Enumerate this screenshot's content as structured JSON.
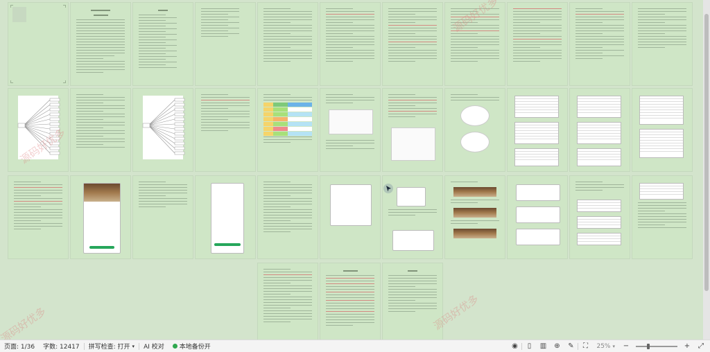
{
  "status": {
    "page_label": "页面: 1/36",
    "word_count_label": "字数: 12417",
    "spell_check_label": "拼写检查: 打开",
    "proof_label": "AI 校对",
    "backup_label": "本地备份开",
    "zoom_level": "25%"
  },
  "watermark": {
    "text": "源码好优多"
  },
  "colors": {
    "page_bg": "#cfe6c6",
    "workspace_bg": "#d3e4cc",
    "accent_green": "#2fa84f"
  }
}
